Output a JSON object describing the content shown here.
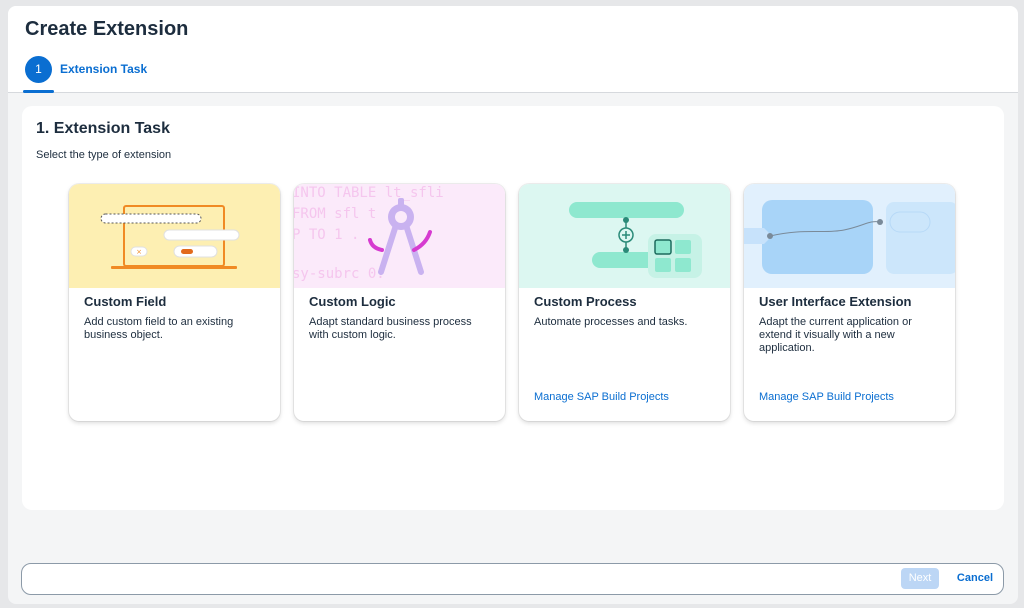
{
  "header": {
    "title": "Create Extension",
    "step_number": "1",
    "step_label": "Extension Task"
  },
  "section": {
    "title": "1. Extension Task",
    "subtitle": "Select the type of extension"
  },
  "cards": [
    {
      "title": "Custom Field",
      "description": "Add custom field to an existing business object.",
      "link": "",
      "art_color": "#fdefb2",
      "icon": "laptop-form-icon"
    },
    {
      "title": "Custom Logic",
      "description": "Adapt standard business process with custom logic.",
      "link": "",
      "art_color": "#fbeafa",
      "icon": "compass-tool-icon",
      "code_lines": [
        "INTO TABLE lt_sfli",
        "FROM sfl t",
        "P TO 1   .",
        "",
        "sy-subrc   0."
      ]
    },
    {
      "title": "Custom Process",
      "description": "Automate processes and tasks.",
      "link": "Manage SAP Build Projects",
      "art_color": "#dcf7f1",
      "icon": "process-flow-icon"
    },
    {
      "title": "User Interface Extension",
      "description": "Adapt the current application or extend it visually with a new application.",
      "link": "Manage SAP Build Projects",
      "art_color": "#e1f0fd",
      "icon": "ui-windows-icon"
    }
  ],
  "footer": {
    "next_label": "Next",
    "cancel_label": "Cancel"
  },
  "colors": {
    "accent": "#0a6ed1",
    "text": "#1d2d3e"
  }
}
